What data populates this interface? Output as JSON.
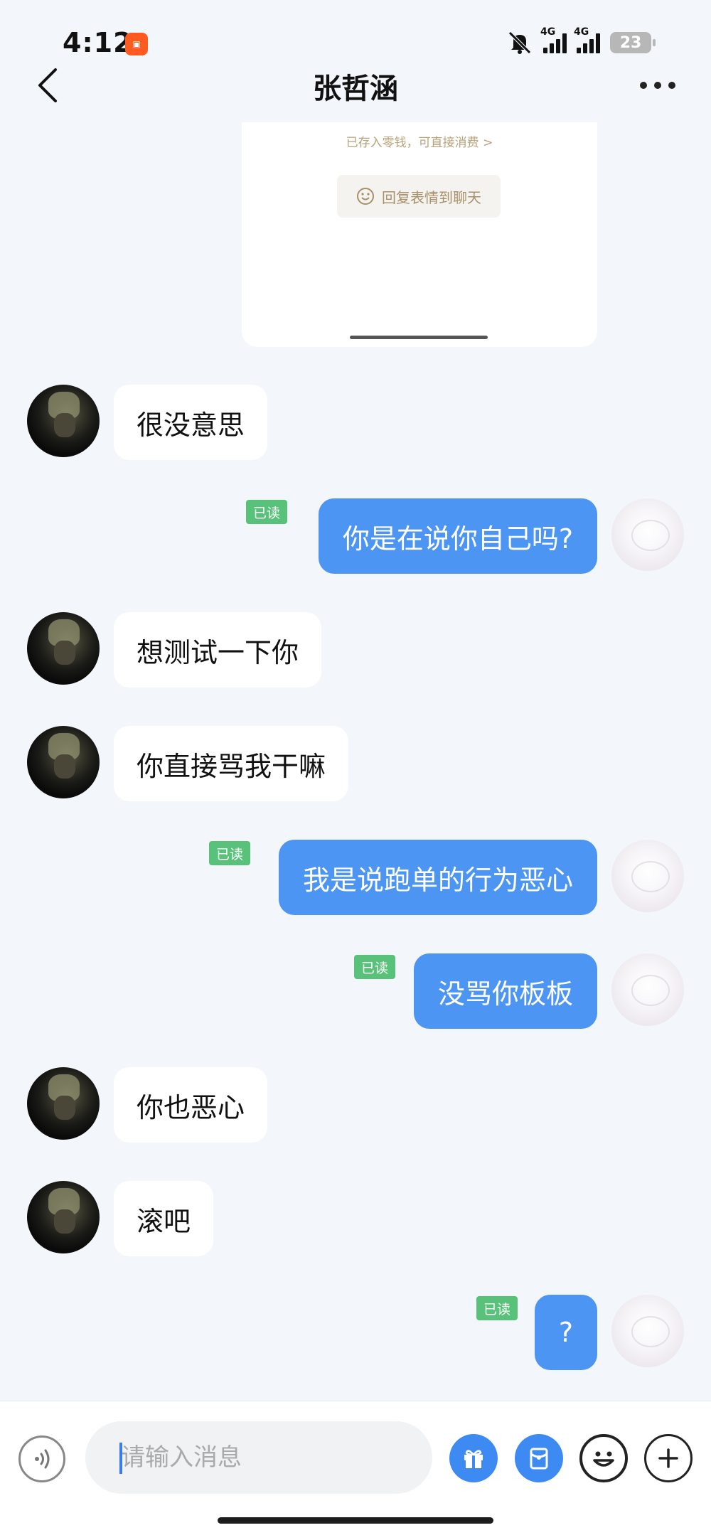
{
  "status_bar": {
    "time": "4:12",
    "battery": "23",
    "network_1": "4G",
    "network_2": "4G"
  },
  "header": {
    "title": "张哲涵"
  },
  "card": {
    "note": "已存入零钱，可直接消费 >",
    "reply_label": "回复表情到聊天"
  },
  "messages": [
    {
      "side": "left",
      "text": "很没意思"
    },
    {
      "side": "right",
      "text": "你是在说你自己吗?",
      "status": "已读"
    },
    {
      "side": "left",
      "text": "想测试一下你"
    },
    {
      "side": "left",
      "text": "你直接骂我干嘛"
    },
    {
      "side": "right",
      "text": "我是说跑单的行为恶心",
      "status": "已读"
    },
    {
      "side": "right",
      "text": "没骂你板板",
      "status": "已读"
    },
    {
      "side": "left",
      "text": "你也恶心"
    },
    {
      "side": "left",
      "text": "滚吧"
    },
    {
      "side": "right",
      "text": "?",
      "status": "已读"
    }
  ],
  "input": {
    "placeholder": "请输入消息"
  },
  "colors": {
    "bubble_right": "#4c95f3",
    "read_tag": "#59c27a",
    "background": "#f3f6fa"
  }
}
